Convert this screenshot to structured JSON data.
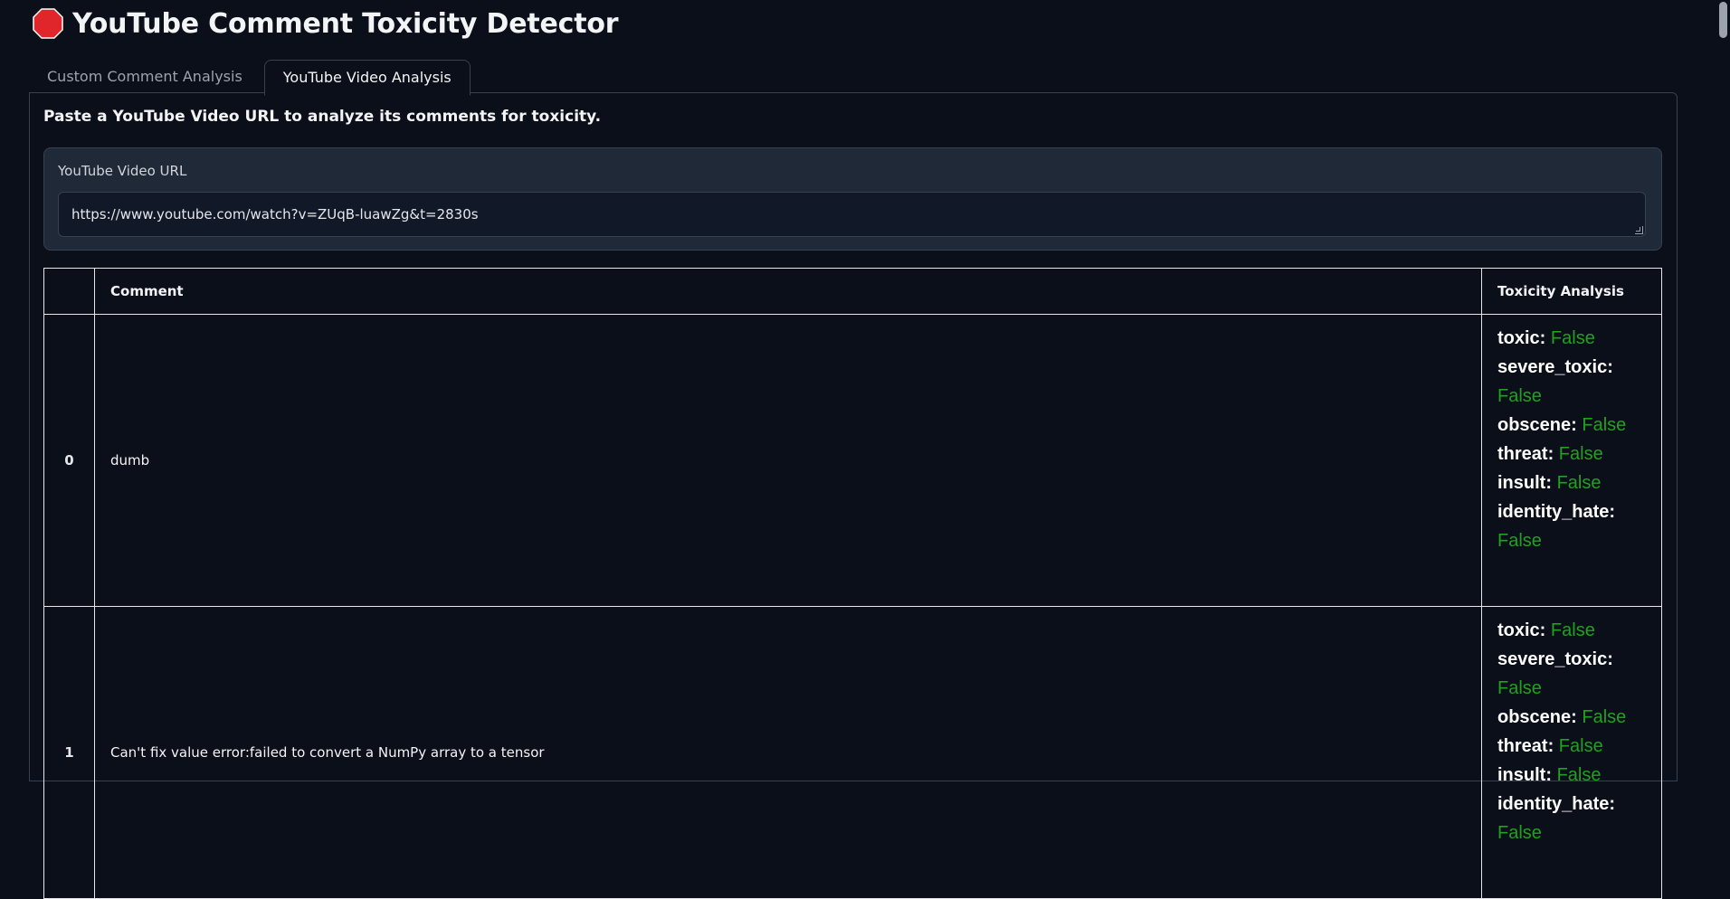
{
  "app": {
    "title": "YouTube Comment Toxicity Detector"
  },
  "tabs": [
    {
      "label": "Custom Comment Analysis"
    },
    {
      "label": "YouTube Video Analysis"
    }
  ],
  "main": {
    "instructions": "Paste a YouTube Video URL to analyze its comments for toxicity.",
    "url_field": {
      "label": "YouTube Video URL",
      "value": "https://www.youtube.com/watch?v=ZUqB-luawZg&t=2830s"
    }
  },
  "table": {
    "headers": [
      "",
      "Comment",
      "Toxicity Analysis"
    ],
    "rows": [
      {
        "index": "0",
        "comment": "dumb",
        "analysis": [
          {
            "label": "toxic:",
            "value": "False"
          },
          {
            "label": "severe_toxic:",
            "value": "False"
          },
          {
            "label": "obscene:",
            "value": "False"
          },
          {
            "label": "threat:",
            "value": "False"
          },
          {
            "label": "insult:",
            "value": "False"
          },
          {
            "label": "identity_hate:",
            "value": "False"
          }
        ]
      },
      {
        "index": "1",
        "comment": "Can't fix value error:failed to convert a NumPy array to a tensor",
        "analysis": [
          {
            "label": "toxic:",
            "value": "False"
          },
          {
            "label": "severe_toxic:",
            "value": "False"
          },
          {
            "label": "obscene:",
            "value": "False"
          },
          {
            "label": "threat:",
            "value": "False"
          },
          {
            "label": "insult:",
            "value": "False"
          },
          {
            "label": "identity_hate:",
            "value": "False"
          }
        ]
      }
    ]
  },
  "colors": {
    "background": "#0b0f19",
    "false_value": "#22a022",
    "stop_icon": "#e0262b"
  }
}
